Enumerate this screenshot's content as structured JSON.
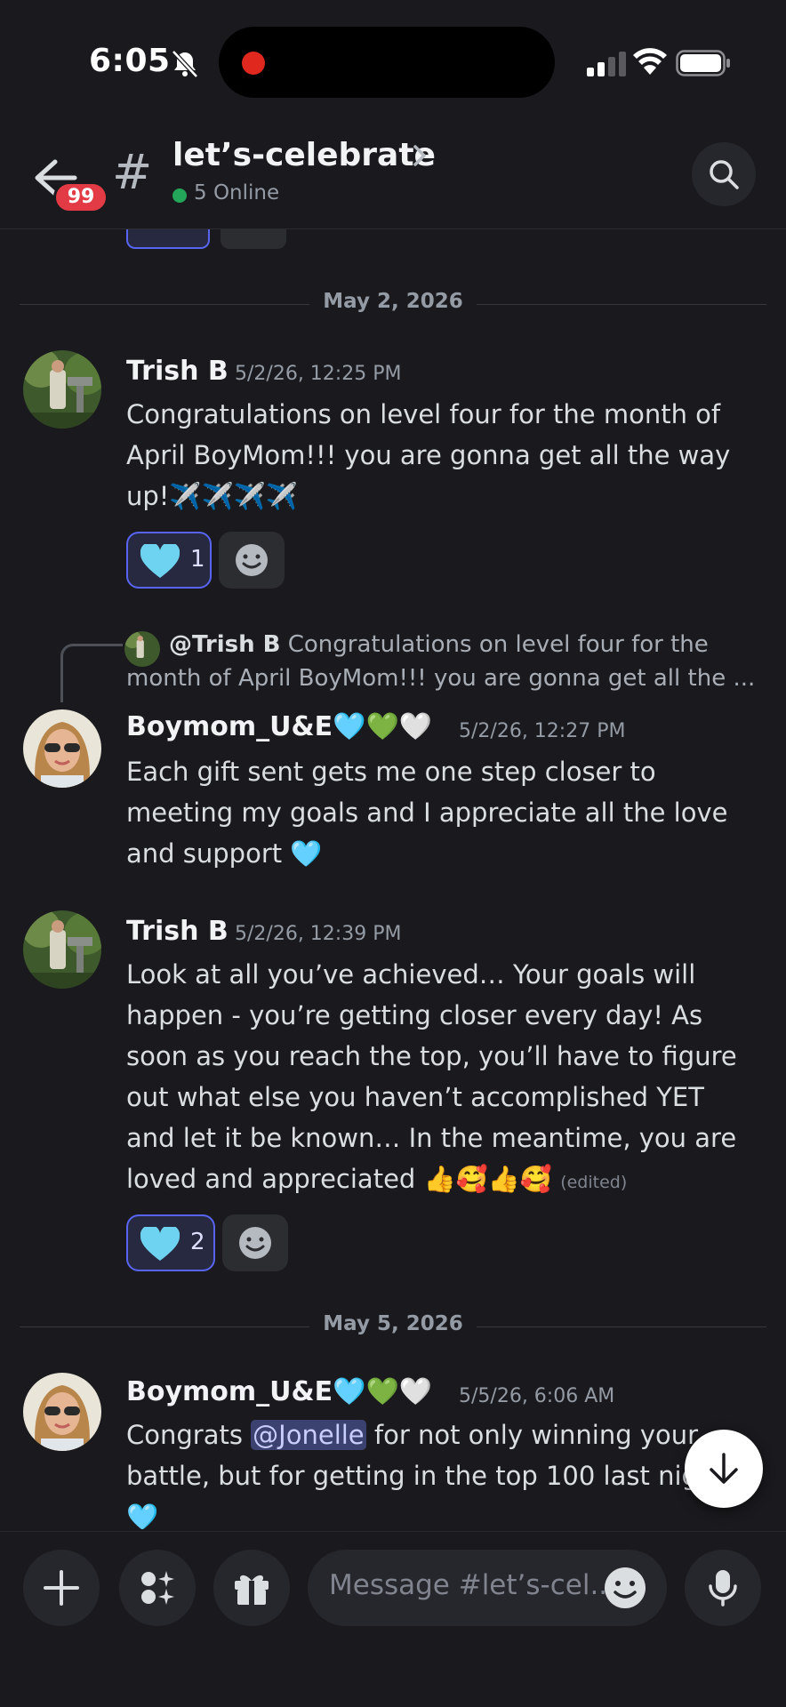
{
  "status_bar": {
    "time": "6:05"
  },
  "header": {
    "unread_badge": "99",
    "channel_hash": "#",
    "channel_name": "let’s-celebrate",
    "online": "5 Online"
  },
  "dividers": [
    "May 2, 2026",
    "May 5, 2026"
  ],
  "messages": [
    {
      "author": "Trish B",
      "timestamp": "5/2/26, 12:25 PM",
      "lines": [
        "Congratulations on level four for the month of",
        "April BoyMom!!!  you are gonna get all the way",
        "up!✈️✈️✈️✈️"
      ],
      "reaction": {
        "emoji": "🩵",
        "count": "1"
      }
    },
    {
      "reply_to": {
        "author": "@Trish B",
        "preview_1": "Congratulations on level four for the",
        "preview_2": "month of April BoyMom!!!  you are gonna get all the ..."
      },
      "author": "Boymom_U&E🩵💚🤍",
      "timestamp": "5/2/26, 12:27 PM",
      "lines": [
        "Each gift sent gets me one step closer to",
        "meeting my goals and I appreciate all the love",
        "and support 🩵"
      ]
    },
    {
      "author": "Trish B",
      "timestamp": "5/2/26, 12:39 PM",
      "lines": [
        "Look at all you’ve achieved… Your goals will",
        "happen - you’re getting closer every day!  As",
        "soon as you reach the top, you’ll have to figure",
        "out what else you haven’t accomplished YET",
        "and let it be known… In the meantime, you are",
        "loved and appreciated 👍🥰👍🥰"
      ],
      "edited": "(edited)",
      "reaction": {
        "emoji": "🩵",
        "count": "2"
      }
    },
    {
      "author": "Boymom_U&E🩵💚🤍",
      "timestamp": "5/5/26, 6:06 AM",
      "line1_pre": "Congrats ",
      "mention": "@Jonelle",
      "line1_post": " for not only winning your",
      "line2": "battle, but for getting in the top 100 last night",
      "line3": "🩵"
    }
  ],
  "composer": {
    "placeholder": "Message #let’s-cel.."
  },
  "colors": {
    "accent": "#5865f2",
    "online": "#23a55a",
    "badge": "#e33b45",
    "background": "#1a1a1e"
  },
  "icons": [
    "bell-off-icon",
    "signal-icon",
    "wifi-icon",
    "battery-icon",
    "back-arrow-icon",
    "chevron-right-icon",
    "search-icon",
    "smile-icon",
    "arrow-down-icon",
    "plus-icon",
    "apps-icon",
    "gift-icon",
    "microphone-icon"
  ]
}
